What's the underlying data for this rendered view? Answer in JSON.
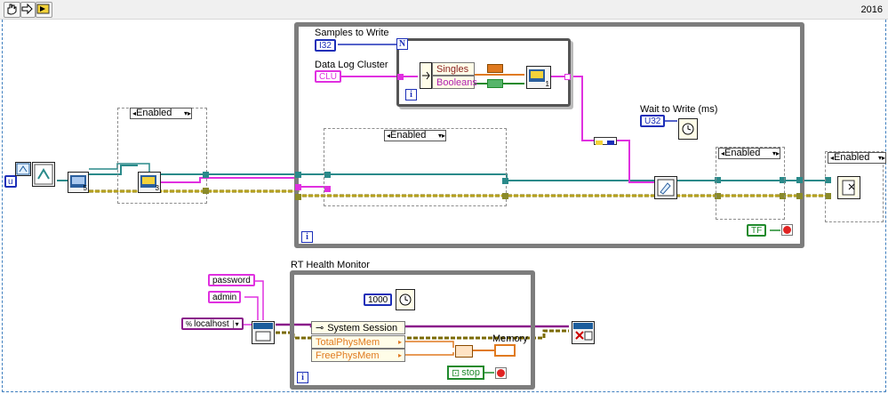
{
  "toolbar": {
    "icons": [
      "hand-icon",
      "arrow-icon",
      "run-arrow-icon"
    ],
    "version": "2016"
  },
  "main_loop": {
    "iteration_glyph": "i"
  },
  "for_loop": {
    "count_glyph": "N",
    "iteration_glyph": "i"
  },
  "labels": {
    "samples_to_write": "Samples to Write",
    "data_log_cluster": "Data Log Cluster",
    "wait_to_write": "Wait to Write (ms)",
    "rt_health_monitor": "RT Health Monitor",
    "memory": "Memory"
  },
  "constants": {
    "samples_type": "I32",
    "wait_type": "U32",
    "cluster_type": "CLU",
    "tf": "TF",
    "wait_ms": "1000",
    "password": "password",
    "admin": "admin",
    "localhost": "localhost",
    "u": "u"
  },
  "unbundle": {
    "rows": [
      "Singles",
      "Booleans"
    ]
  },
  "system_session": {
    "title": "System Session",
    "rows": [
      "TotalPhysMem",
      "FreePhysMem"
    ]
  },
  "disable_structures": {
    "left": "Enabled",
    "inner": "Enabled",
    "right_inner": "Enabled",
    "right": "Enabled"
  },
  "stop_control": "stop",
  "vi_numbers": {
    "open": "5",
    "second": "3",
    "write": "1"
  },
  "colors": {
    "loop_border": "#7d7d7d",
    "diagram_dashed": "#3f7fbf",
    "numeric_int": "#1c2fb8",
    "string_wire": "#e030e0",
    "error_wire": "#7a6a00",
    "refnum_wire": "#2a8a8a",
    "boolean_wire": "#1f8a2c",
    "orange_wire": "#e07a20"
  }
}
